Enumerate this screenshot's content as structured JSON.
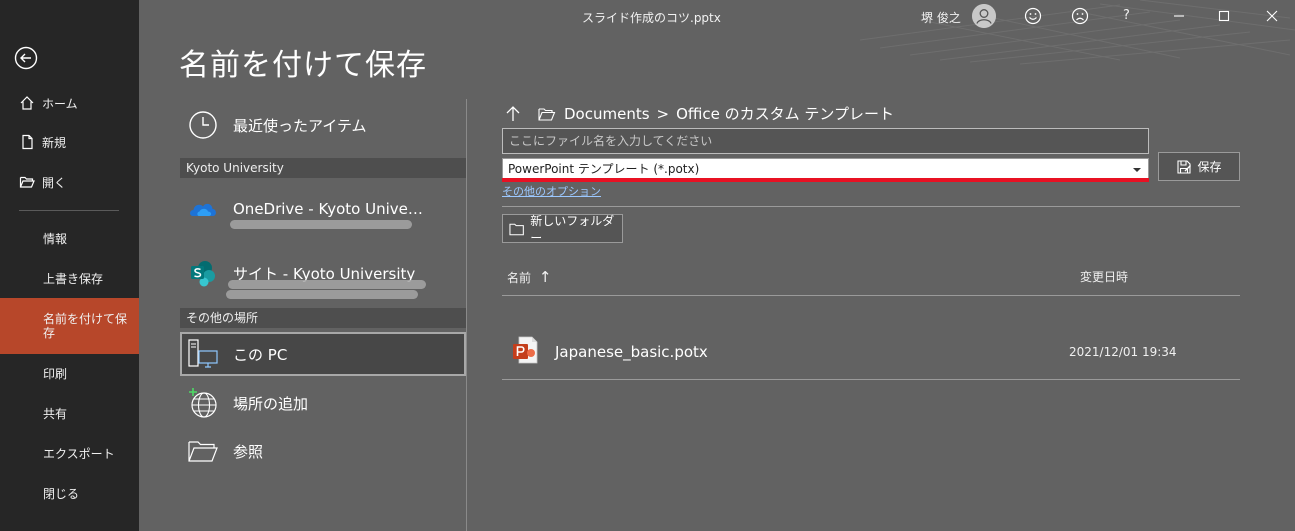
{
  "titlebar": {
    "document_title": "スライド作成のコツ.pptx",
    "user_name": "堺 俊之",
    "help_label": "?"
  },
  "nav": {
    "items": [
      {
        "label": "ホーム",
        "icon": "home-icon"
      },
      {
        "label": "新規",
        "icon": "new-document-icon"
      },
      {
        "label": "開く",
        "icon": "open-folder-icon"
      },
      {
        "label": "情報"
      },
      {
        "label": "上書き保存"
      },
      {
        "label": "名前を付けて保存",
        "active": true
      },
      {
        "label": "印刷"
      },
      {
        "label": "共有"
      },
      {
        "label": "エクスポート"
      },
      {
        "label": "閉じる"
      }
    ],
    "active_color": "#b7472a"
  },
  "page": {
    "title": "名前を付けて保存"
  },
  "locations": {
    "recent": "最近使ったアイテム",
    "org_header": "Kyoto University",
    "onedrive": "OneDrive - Kyoto Unive…",
    "sites": "サイト - Kyoto University",
    "other_header": "その他の場所",
    "this_pc": "この PC",
    "add_place": "場所の追加",
    "browse": "参照"
  },
  "save_pane": {
    "breadcrumb": {
      "folder": "Documents",
      "separator": ">",
      "subfolder": "Office のカスタム テンプレート"
    },
    "filename_placeholder": "ここにファイル名を入力してください",
    "filetype": "PowerPoint テンプレート (*.potx)",
    "more_options": "その他のオプション",
    "save_label": "保存",
    "new_folder_label": "新しいフォルダー",
    "columns": {
      "name": "名前",
      "sort_arrow": "↑",
      "modified": "変更日時"
    },
    "files": [
      {
        "name": "Japanese_basic.potx",
        "modified": "2021/12/01 19:34",
        "icon": "powerpoint-file-icon"
      }
    ],
    "highlight_color": "#e81123"
  }
}
